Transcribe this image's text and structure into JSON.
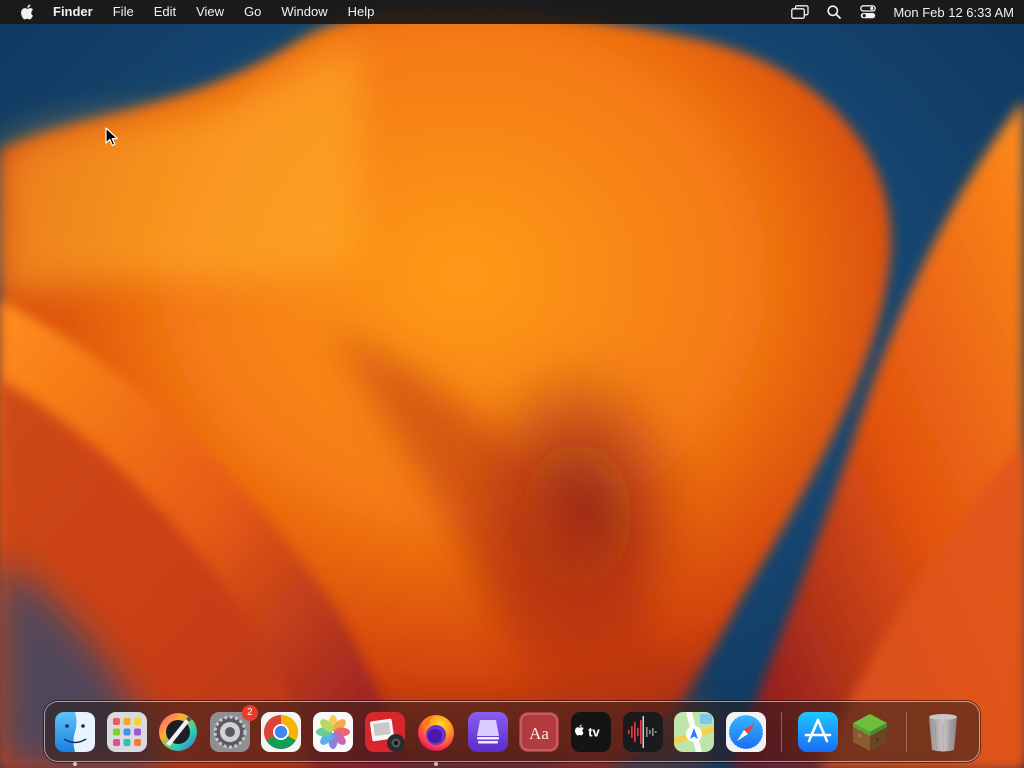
{
  "menubar": {
    "apple_icon": "apple-logo-icon",
    "app_name": "Finder",
    "menus": [
      "File",
      "Edit",
      "View",
      "Go",
      "Window",
      "Help"
    ],
    "status_icons": [
      "screen-mirroring-icon",
      "spotlight-search-icon",
      "control-center-icon"
    ],
    "clock": "Mon Feb 12  6:33 AM"
  },
  "dock": {
    "apps": [
      {
        "id": "finder",
        "icon": "finder-icon",
        "running": true
      },
      {
        "id": "launchpad",
        "icon": "launchpad-icon",
        "running": false
      },
      {
        "id": "pixelmator",
        "icon": "paint-app-icon",
        "running": false
      },
      {
        "id": "system-settings",
        "icon": "system-settings-icon",
        "running": false,
        "badge": "2"
      },
      {
        "id": "chrome",
        "icon": "chrome-icon",
        "running": false
      },
      {
        "id": "photos",
        "icon": "photos-icon",
        "running": false
      },
      {
        "id": "photo-booth",
        "icon": "photo-booth-icon",
        "running": false
      },
      {
        "id": "firefox",
        "icon": "firefox-icon",
        "running": true
      },
      {
        "id": "app-purple",
        "icon": "purple-stack-icon",
        "running": false
      },
      {
        "id": "dictionary",
        "icon": "dictionary-icon",
        "running": false,
        "label": "Aa"
      },
      {
        "id": "apple-tv",
        "icon": "apple-tv-icon",
        "running": false,
        "label": "tv"
      },
      {
        "id": "voice-memos",
        "icon": "voice-memos-icon",
        "running": false
      },
      {
        "id": "maps",
        "icon": "maps-icon",
        "running": false
      },
      {
        "id": "safari",
        "icon": "safari-icon",
        "running": false
      }
    ],
    "secondary": [
      {
        "id": "app-store",
        "icon": "app-store-icon",
        "running": false
      },
      {
        "id": "minecraft",
        "icon": "minecraft-icon",
        "running": false
      }
    ],
    "trash": {
      "id": "trash",
      "icon": "trash-icon"
    }
  },
  "colors": {
    "wallpaper_blue": "#12426b",
    "wallpaper_orange": "#f7941d",
    "menubar_bg": "#1c1816",
    "badge_red": "#ea3b2e"
  }
}
